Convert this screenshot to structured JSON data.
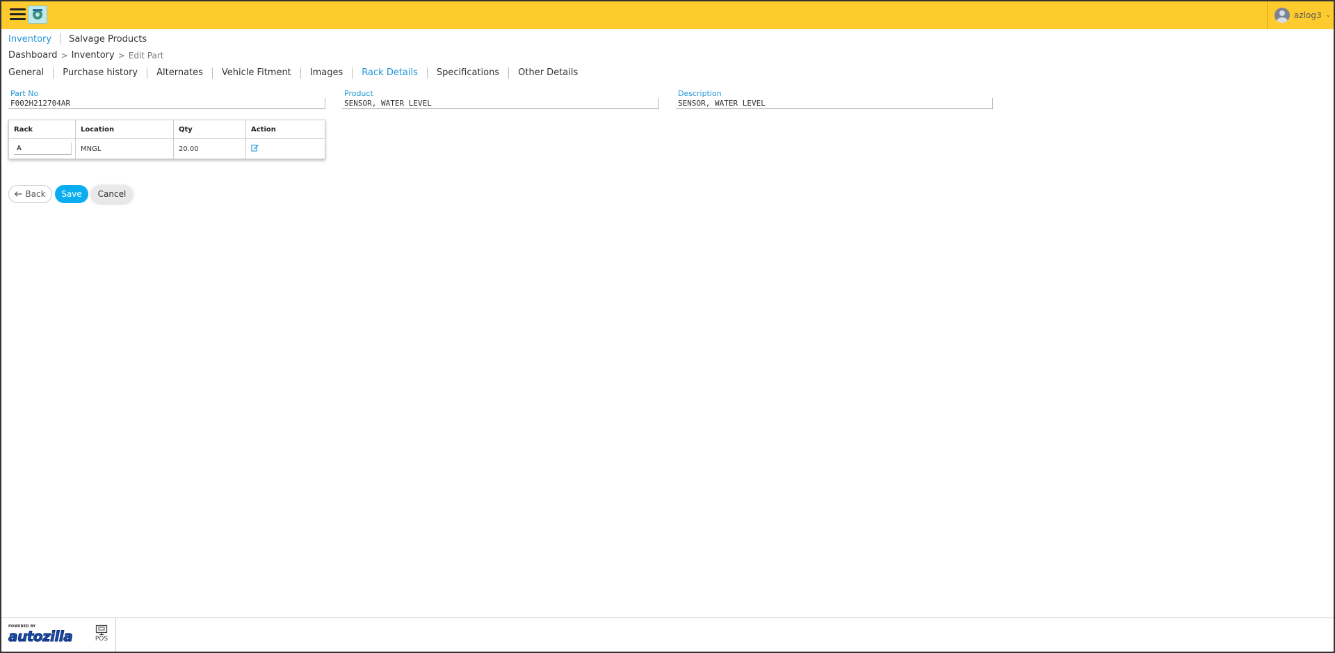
{
  "header": {
    "username": "azlog3",
    "menu_icon": "hamburger-menu-icon",
    "logo_icon": "company-logo-icon"
  },
  "module_nav": {
    "items": [
      {
        "label": "Inventory",
        "active": true
      },
      {
        "label": "Salvage Products",
        "active": false
      }
    ]
  },
  "breadcrumb": {
    "items": [
      "Dashboard",
      "Inventory"
    ],
    "current": "Edit Part",
    "separator": ">"
  },
  "tabs": [
    {
      "label": "General",
      "active": false
    },
    {
      "label": "Purchase history",
      "active": false
    },
    {
      "label": "Alternates",
      "active": false
    },
    {
      "label": "Vehicle Fitment",
      "active": false
    },
    {
      "label": "Images",
      "active": false
    },
    {
      "label": "Rack Details",
      "active": true
    },
    {
      "label": "Specifications",
      "active": false
    },
    {
      "label": "Other Details",
      "active": false
    }
  ],
  "fields": {
    "part_no": {
      "label": "Part No",
      "value": "F002H212704AR"
    },
    "product": {
      "label": "Product",
      "value": "SENSOR, WATER LEVEL"
    },
    "description": {
      "label": "Description",
      "value": "SENSOR, WATER LEVEL"
    }
  },
  "rack_table": {
    "headers": [
      "Rack",
      "Location",
      "Qty",
      "Action"
    ],
    "rows": [
      {
        "rack": "A",
        "location": "MNGL",
        "qty": "20.00",
        "action_icon": "edit-icon"
      }
    ]
  },
  "buttons": {
    "back": "Back",
    "save": "Save",
    "cancel": "Cancel"
  },
  "footer": {
    "powered_by": "POWERED BY",
    "brand": "autozilla",
    "pos_label": "POS"
  },
  "colors": {
    "topbar": "#fecb2e",
    "accent": "#2196d6",
    "save_button": "#0aaef0"
  }
}
